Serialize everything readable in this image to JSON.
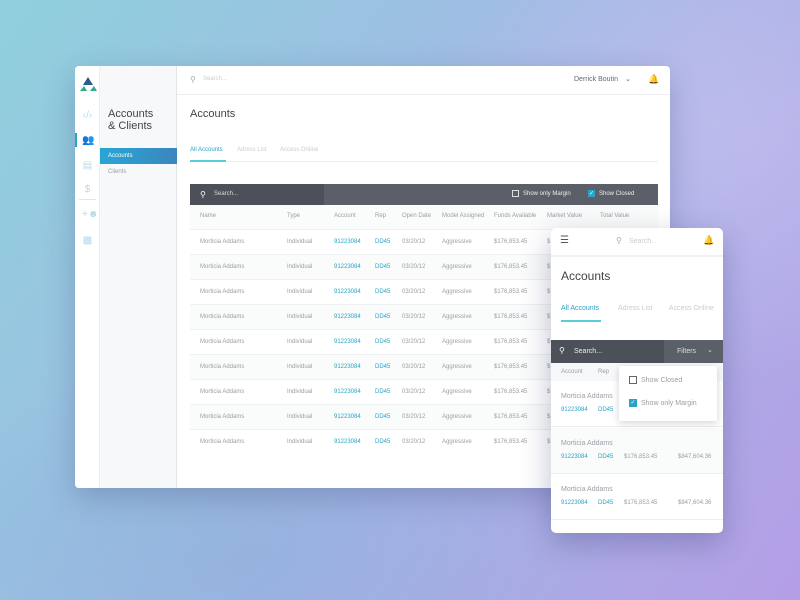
{
  "colors": {
    "accent": "#2aa3c5",
    "toolbar": "#4d525b",
    "sidebar_active": "#2f8fc8"
  },
  "desktop": {
    "search_placeholder": "Search...",
    "user_name": "Derrick Boutin",
    "rail_icons": [
      "code-icon",
      "users-icon",
      "book-icon",
      "dollar-icon",
      "add-user-icon",
      "chat-icon"
    ],
    "section_title_1": "Accounts",
    "section_title_2": "& Clients",
    "sidebar": [
      {
        "label": "Accounts",
        "active": true
      },
      {
        "label": "Clients",
        "active": false
      }
    ],
    "page_title": "Accounts",
    "tabs": [
      {
        "label": "All Accounts",
        "active": true
      },
      {
        "label": "Adress List"
      },
      {
        "label": "Access Online"
      }
    ],
    "table_search_placeholder": "Search...",
    "filters": [
      {
        "label": "Show only Margin",
        "checked": false
      },
      {
        "label": "Show Closed",
        "checked": true
      }
    ],
    "columns": [
      "Name",
      "Type",
      "Account",
      "Rep",
      "Open Date",
      "Model Assigned",
      "Funds Available",
      "Market Value",
      "Total Value"
    ],
    "rows": [
      [
        "Morticia Addams",
        "Individual",
        "91223084",
        "DD45",
        "03/20/12",
        "Aggressive",
        "$176,853.45",
        "$"
      ],
      [
        "Morticia Addams",
        "Individual",
        "91223084",
        "DD45",
        "03/20/12",
        "Aggressive",
        "$176,853.45",
        "$"
      ],
      [
        "Morticia Addams",
        "Individual",
        "91223084",
        "DD45",
        "03/20/12",
        "Aggressive",
        "$176,853.45",
        "$"
      ],
      [
        "Morticia Addams",
        "Individual",
        "91223084",
        "DD45",
        "03/20/12",
        "Aggressive",
        "$176,853.45",
        "$"
      ],
      [
        "Morticia Addams",
        "Individual",
        "91223084",
        "DD45",
        "03/20/12",
        "Aggressive",
        "$176,853.45",
        "$"
      ],
      [
        "Morticia Addams",
        "Individual",
        "91223084",
        "DD45",
        "03/20/12",
        "Aggressive",
        "$176,853.45",
        "$"
      ],
      [
        "Morticia Addams",
        "Individual",
        "91223084",
        "DD45",
        "03/20/12",
        "Aggressive",
        "$176,853.45",
        "$"
      ],
      [
        "Morticia Addams",
        "Individual",
        "91223084",
        "DD45",
        "03/20/12",
        "Aggressive",
        "$176,853.45",
        "$"
      ],
      [
        "Morticia Addams",
        "Individual",
        "91223084",
        "DD45",
        "03/20/12",
        "Aggressive",
        "$176,853.45",
        "$"
      ]
    ]
  },
  "mobile": {
    "search_placeholder": "Search...",
    "page_title": "Accounts",
    "tabs": [
      {
        "label": "All Accounts",
        "active": true
      },
      {
        "label": "Adress List"
      },
      {
        "label": "Access Online"
      }
    ],
    "table_search_placeholder": "Search...",
    "filters_label": "Filters",
    "columns": [
      "Account",
      "Rep"
    ],
    "dropdown": [
      {
        "label": "Show Closed",
        "checked": false
      },
      {
        "label": "Show only Margin",
        "checked": true
      }
    ],
    "rows": [
      {
        "name": "Morticia Addams",
        "account": "91223084",
        "rep": "DD45",
        "funds": "",
        "total": ""
      },
      {
        "name": "Morticia Addams",
        "account": "91223084",
        "rep": "DD45",
        "funds": "$176,853.45",
        "total": "$847,604.36"
      },
      {
        "name": "Morticia Addams",
        "account": "91223084",
        "rep": "DD45",
        "funds": "$176,853.45",
        "total": "$847,604.36"
      }
    ]
  }
}
